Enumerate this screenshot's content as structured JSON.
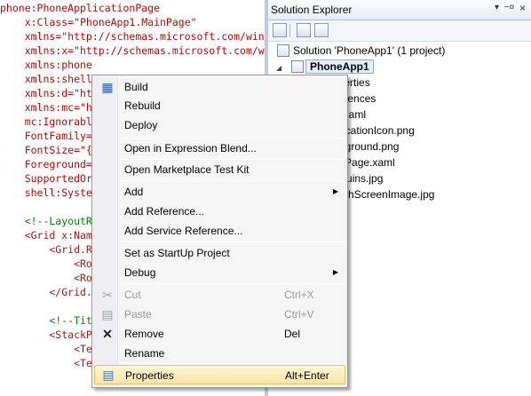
{
  "editor": {
    "lines": [
      {
        "t": "phone:PhoneApplicationPage",
        "c": "red"
      },
      {
        "t": "    x:Class=\"PhoneApp1.MainPage\"",
        "c": "mixed"
      },
      {
        "t": "    xmlns=\"http://schemas.microsoft.com/win",
        "c": "blue"
      },
      {
        "t": "    xmlns:x=\"http://schemas.microsoft.com/w",
        "c": "blue"
      },
      {
        "t": "    xmlns:phone",
        "c": "red"
      },
      {
        "t": "    xmlns:shell",
        "c": "red"
      },
      {
        "t": "    xmlns:d=\"ht",
        "c": "red"
      },
      {
        "t": "    xmlns:mc=\"ht",
        "c": "red"
      },
      {
        "t": "    mc:Ignorable",
        "c": "red"
      },
      {
        "t": "    FontFamily=\"",
        "c": "red"
      },
      {
        "t": "    FontSize=\"{S",
        "c": "red"
      },
      {
        "t": "    Foreground=\"",
        "c": "red"
      },
      {
        "t": "    SupportedOri",
        "c": "red"
      },
      {
        "t": "    shell:System",
        "c": "red"
      },
      {
        "t": "",
        "c": "dk"
      },
      {
        "t": "    <!--LayoutRo",
        "c": "green"
      },
      {
        "t": "    <Grid x:Name",
        "c": "brown"
      },
      {
        "t": "        <Grid.Ro",
        "c": "brown"
      },
      {
        "t": "            <Row",
        "c": "brown"
      },
      {
        "t": "            <Row",
        "c": "brown"
      },
      {
        "t": "        </Grid.R",
        "c": "brown"
      },
      {
        "t": "",
        "c": "dk"
      },
      {
        "t": "        <!--Titl",
        "c": "green"
      },
      {
        "t": "        <StackPa",
        "c": "brown"
      },
      {
        "t": "            <Tex",
        "c": "brown"
      },
      {
        "t": "            <TextBlock x:Name=\"PageTitle\" T",
        "c": "brown"
      }
    ]
  },
  "solution_explorer": {
    "title": "Solution Explorer",
    "pin_glyph": "−¤",
    "dropdown_glyph": "▾",
    "close_glyph": "×",
    "solution_label": "Solution 'PhoneApp1' (1 project)",
    "project_label": "PhoneApp1",
    "items": [
      "Properties",
      "References",
      "App.xaml",
      "ApplicationIcon.png",
      "Background.png",
      "MainPage.xaml",
      "Penguins.jpg",
      "SplashScreenImage.jpg"
    ]
  },
  "context_menu": {
    "items": [
      {
        "label": "Build",
        "shortcut": "",
        "icon": "build-icon",
        "glyph": "▦",
        "disabled": false,
        "submenu": false
      },
      {
        "label": "Rebuild",
        "shortcut": "",
        "icon": "",
        "glyph": "",
        "disabled": false,
        "submenu": false
      },
      {
        "label": "Deploy",
        "shortcut": "",
        "icon": "",
        "glyph": "",
        "disabled": false,
        "submenu": false
      },
      {
        "label": "Open in Expression Blend...",
        "shortcut": "",
        "icon": "",
        "glyph": "",
        "disabled": false,
        "submenu": false
      },
      {
        "label": "Open Marketplace Test Kit",
        "shortcut": "",
        "icon": "",
        "glyph": "",
        "disabled": false,
        "submenu": false
      },
      {
        "label": "Add",
        "shortcut": "",
        "icon": "",
        "glyph": "",
        "disabled": false,
        "submenu": true
      },
      {
        "label": "Add Reference...",
        "shortcut": "",
        "icon": "",
        "glyph": "",
        "disabled": false,
        "submenu": false
      },
      {
        "label": "Add Service Reference...",
        "shortcut": "",
        "icon": "",
        "glyph": "",
        "disabled": false,
        "submenu": false
      },
      {
        "label": "Set as StartUp Project",
        "shortcut": "",
        "icon": "",
        "glyph": "",
        "disabled": false,
        "submenu": false
      },
      {
        "label": "Debug",
        "shortcut": "",
        "icon": "",
        "glyph": "",
        "disabled": false,
        "submenu": true
      },
      {
        "label": "Cut",
        "shortcut": "Ctrl+X",
        "icon": "scissors-icon",
        "glyph": "✂",
        "disabled": true,
        "submenu": false
      },
      {
        "label": "Paste",
        "shortcut": "Ctrl+V",
        "icon": "paste-icon",
        "glyph": "▤",
        "disabled": true,
        "submenu": false
      },
      {
        "label": "Remove",
        "shortcut": "Del",
        "icon": "remove-icon",
        "glyph": "✕",
        "disabled": false,
        "submenu": false
      },
      {
        "label": "Rename",
        "shortcut": "",
        "icon": "",
        "glyph": "",
        "disabled": false,
        "submenu": false
      },
      {
        "label": "Properties",
        "shortcut": "Alt+Enter",
        "icon": "properties-icon",
        "glyph": "▤",
        "disabled": false,
        "submenu": false
      }
    ],
    "highlighted_label": "Properties",
    "submenu_glyph": "▶"
  },
  "colors": {
    "highlight": "#f8e4a4",
    "xaml_element": "#a31515",
    "xaml_attribute": "#ff0000",
    "xaml_value": "#0000ff",
    "comment": "#008000"
  }
}
